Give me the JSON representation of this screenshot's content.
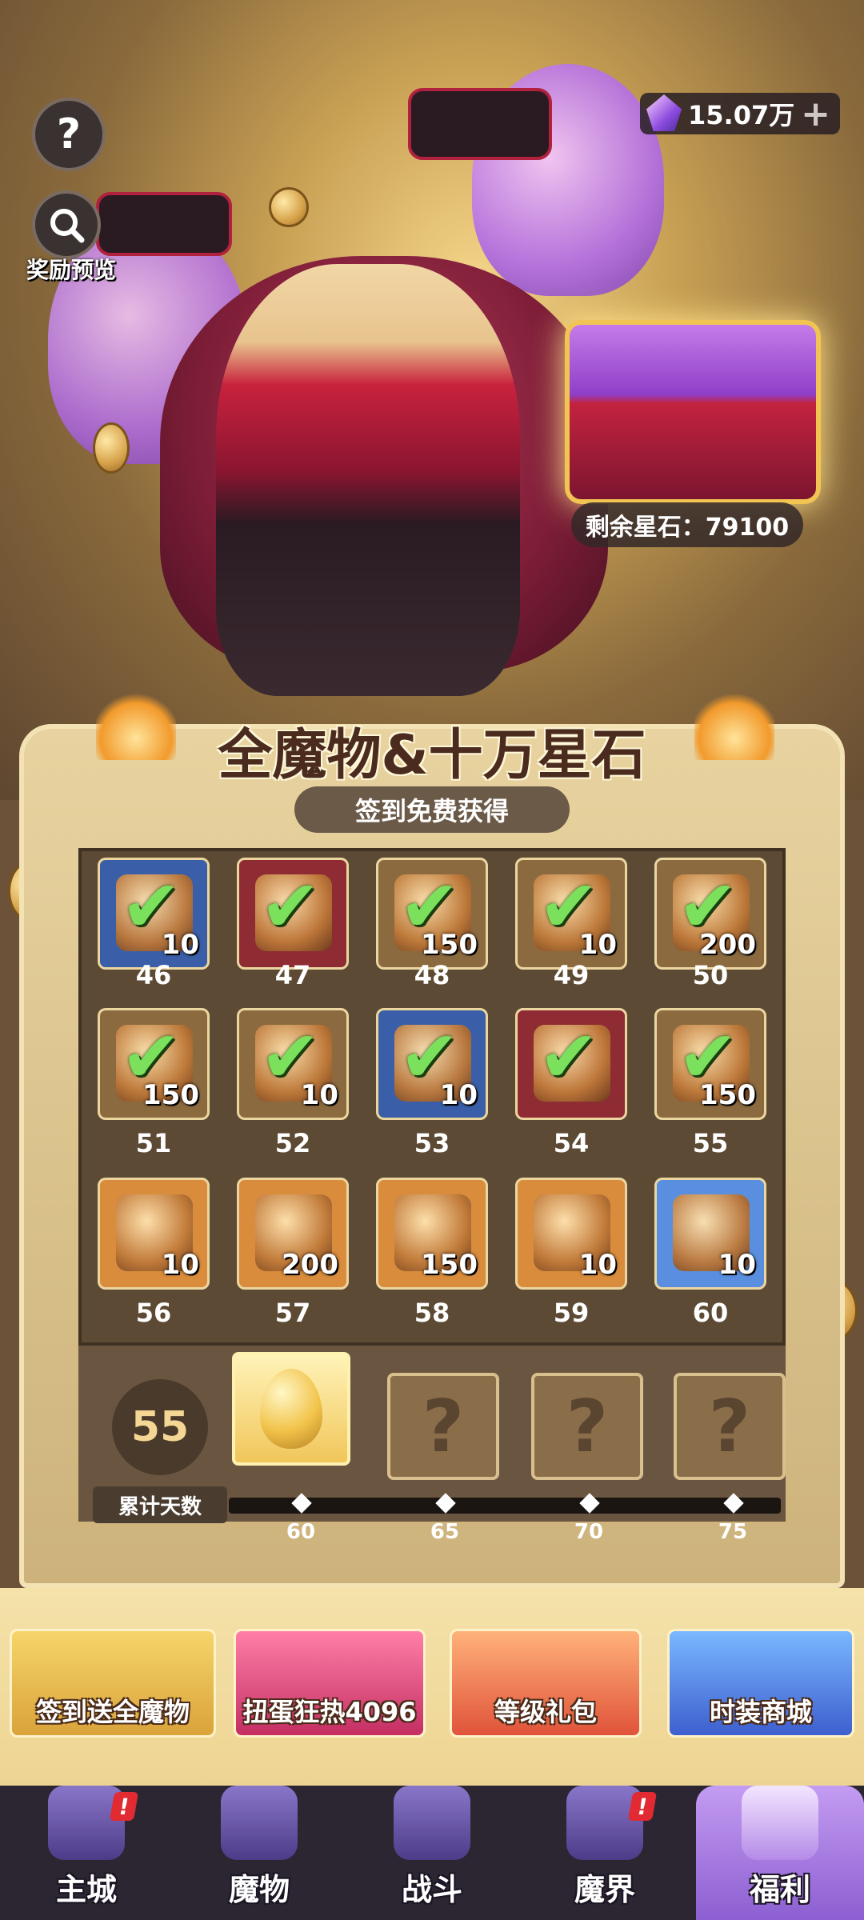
{
  "top": {
    "help_icon": "question-icon",
    "preview_label": "奖励预览",
    "currency_value": "15.07万",
    "currency_plus": "+",
    "remaining_stones": "剩余星石：79100"
  },
  "board": {
    "title": "全魔物&十万星石",
    "subtitle": "签到免费获得",
    "rows": [
      {
        "days": [
          "46",
          "47",
          "48",
          "49",
          "50"
        ],
        "qty": [
          "10",
          "",
          "150",
          "10",
          "200"
        ],
        "bg": [
          "blue",
          "red",
          "brown",
          "brown",
          "brown"
        ],
        "claimed": [
          true,
          true,
          true,
          true,
          true
        ]
      },
      {
        "days": [
          "51",
          "52",
          "53",
          "54",
          "55"
        ],
        "qty": [
          "150",
          "10",
          "10",
          "",
          "150"
        ],
        "bg": [
          "brown",
          "brown",
          "blue",
          "red",
          "brown"
        ],
        "claimed": [
          true,
          true,
          true,
          true,
          true
        ]
      },
      {
        "days": [
          "56",
          "57",
          "58",
          "59",
          "60"
        ],
        "qty": [
          "10",
          "200",
          "150",
          "10",
          "10"
        ],
        "bg": [
          "orange",
          "orange",
          "orange",
          "orange",
          "lightblue"
        ],
        "claimed": [
          false,
          false,
          false,
          false,
          false
        ]
      }
    ]
  },
  "progress": {
    "days_count": "55",
    "days_label": "累计天数",
    "milestones": [
      "60",
      "65",
      "70",
      "75"
    ],
    "locked_symbol": "?"
  },
  "banners": [
    "签到送全魔物",
    "扭蛋狂热4096",
    "等级礼包",
    "时装商城"
  ],
  "nav": {
    "items": [
      "主城",
      "魔物",
      "战斗",
      "魔界",
      "福利"
    ],
    "active": 4,
    "badge": "!"
  },
  "colors": {
    "accent": "#f4d795",
    "check": "#7be05c",
    "badge": "#e12a32"
  }
}
